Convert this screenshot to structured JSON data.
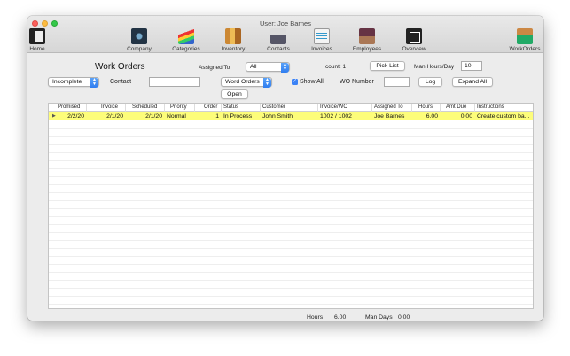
{
  "window": {
    "title": "User: Joe Barnes"
  },
  "toolbar": {
    "home": "Home",
    "company": "Company",
    "categories": "Categories",
    "inventory": "Inventory",
    "contacts": "Contacts",
    "invoices": "Invoices",
    "employees": "Employees",
    "overview": "Overview",
    "workorders": "WorkOrders"
  },
  "form": {
    "heading": "Work Orders",
    "assigned_to_label": "Assigned To",
    "assigned_to_value": "All",
    "count_label": "count: 1",
    "pick_list": "Pick List",
    "man_hours_label": "Man Hours/Day",
    "man_hours_value": "10",
    "status_filter": "Incomplete",
    "contact_label": "Contact",
    "contact_value": "",
    "doc_type": "Word Orders",
    "show_all_label": "Show All",
    "show_all_checked": true,
    "wo_number_label": "WO Number",
    "wo_number_value": "",
    "log": "Log",
    "expand_all": "Expand All",
    "open": "Open"
  },
  "table": {
    "columns": [
      "Promised",
      "Invoice",
      "Scheduled",
      "Priority",
      "Order",
      "Status",
      "Customer",
      "Invoice/WO",
      "Assigned To",
      "Hours",
      "Amt Due",
      "Instructions"
    ],
    "rows": [
      {
        "promised": "2/2/20",
        "invoice": "2/1/20",
        "scheduled": "2/1/20",
        "priority": "Normal",
        "order": "1",
        "status": "In Process",
        "customer": "John Smith",
        "invoice_wo": "1002 / 1002",
        "assigned_to": "Joe Barnes",
        "hours": "6.00",
        "amt_due": "0.00",
        "instructions": "Create custom ba..."
      }
    ]
  },
  "footer": {
    "hours_label": "Hours",
    "hours_value": "6.00",
    "man_days_label": "Man Days",
    "man_days_value": "0.00"
  },
  "colors": {
    "selected_row": "#fdfd7a",
    "accent": "#2f7df0"
  }
}
